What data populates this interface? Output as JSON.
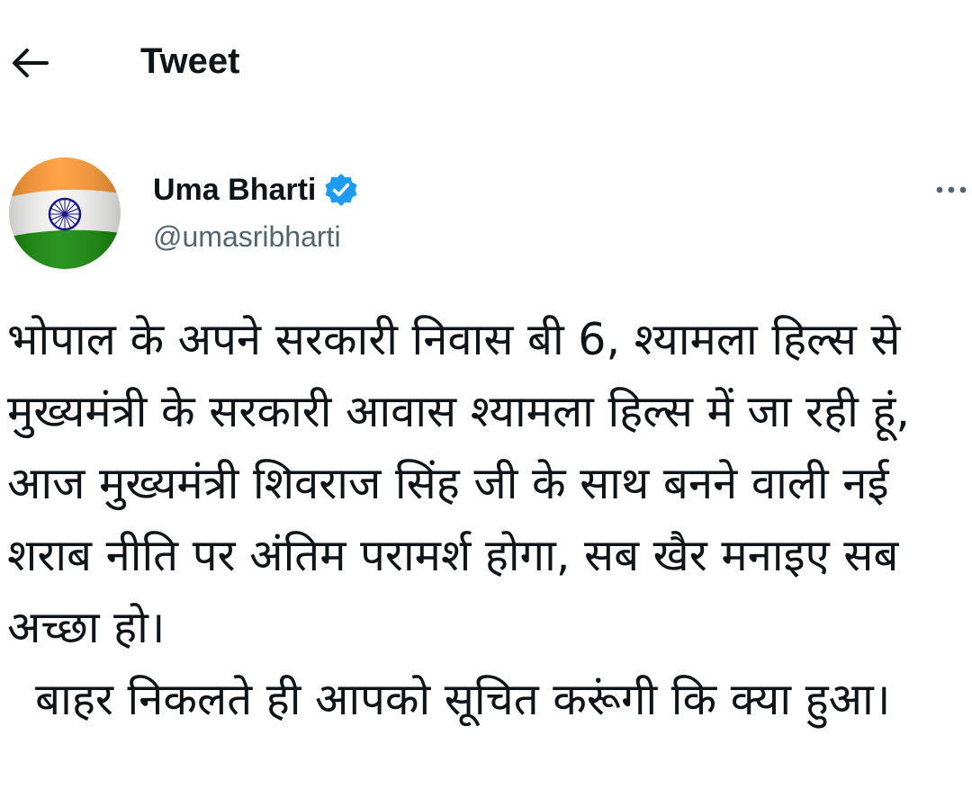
{
  "header": {
    "title": "Tweet",
    "back_icon": "arrow-left-icon"
  },
  "author": {
    "display_name": "Uma Bharti",
    "handle": "@umasribharti",
    "verified": true,
    "verified_icon": "verified-badge-icon",
    "avatar": "indian-flag-avatar",
    "more_icon": "more-options-icon"
  },
  "tweet": {
    "text": "भोपाल के अपने सरकारी निवास बी 6, श्यामला हिल्स से मुख्यमंत्री के सरकारी आवास श्यामला हिल्स में जा रही हूं, आज मुख्यमंत्री शिवराज सिंह जी के साथ बनने वाली नई शराब नीति पर अंतिम परामर्श होगा, सब खैर मनाइए सब अच्छा हो।\n  बाहर निकलते ही आपको सूचित करूंगी कि क्या हुआ।"
  },
  "colors": {
    "text_primary": "#0f1419",
    "text_secondary": "#536471",
    "verified_blue": "#1d9bf0",
    "flag_saffron": "#ff9933",
    "flag_green": "#138808",
    "chakra_blue": "#000080"
  }
}
